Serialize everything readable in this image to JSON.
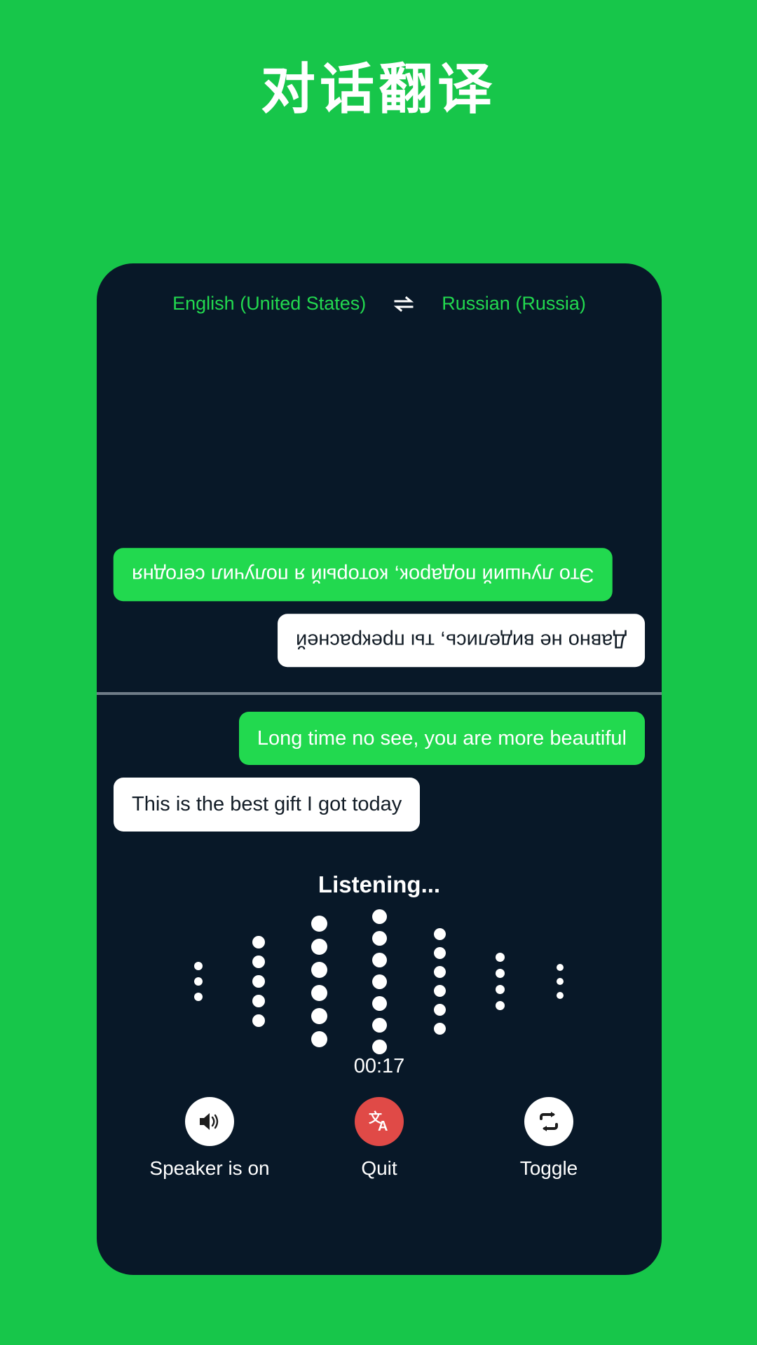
{
  "page": {
    "title": "对话翻译",
    "background_color": "#17c64a",
    "card_color": "#081828"
  },
  "languages": {
    "source": "English (United States)",
    "target": "Russian (Russia)",
    "swap_icon": "swap-horizontal-icon",
    "accent_color": "#22d94f"
  },
  "conversation": {
    "top_pane_messages": [
      {
        "text": "Это лучший подарок, который я получил сегодня",
        "side": "left",
        "style": "green",
        "rotated": true
      },
      {
        "text": "Давно не виделись, ты прекрасней",
        "side": "right",
        "style": "white",
        "rotated": true
      }
    ],
    "bottom_pane_messages": [
      {
        "text": "Long time no see, you are more beautiful",
        "side": "right",
        "style": "green",
        "rotated": false
      },
      {
        "text": "This is the best gift I got today",
        "side": "left",
        "style": "white",
        "rotated": false
      }
    ]
  },
  "status": {
    "listening_label": "Listening...",
    "timer": "00:17"
  },
  "waveform": {
    "dot_color": "#ffffff",
    "columns": [
      {
        "dots": 3,
        "size": 12
      },
      {
        "dots": 5,
        "size": 18
      },
      {
        "dots": 6,
        "size": 23
      },
      {
        "dots": 7,
        "size": 21
      },
      {
        "dots": 6,
        "size": 17
      },
      {
        "dots": 4,
        "size": 13
      },
      {
        "dots": 3,
        "size": 10
      }
    ]
  },
  "controls": [
    {
      "label": "Speaker is on",
      "icon": "speaker-on-icon",
      "circle": "white"
    },
    {
      "label": "Quit",
      "icon": "translate-icon",
      "circle": "red"
    },
    {
      "label": "Toggle",
      "icon": "repeat-icon",
      "circle": "white"
    }
  ]
}
